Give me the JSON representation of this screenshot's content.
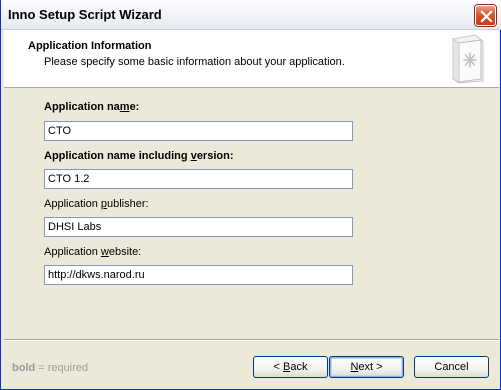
{
  "window": {
    "title": "Inno Setup Script Wizard"
  },
  "header": {
    "title": "Application Information",
    "subtitle": "Please specify some basic information about your application."
  },
  "fields": [
    {
      "label_pre": "Application na",
      "label_accel": "m",
      "label_post": "e:",
      "bold": true,
      "value": "CTO"
    },
    {
      "label_pre": "Application name including ",
      "label_accel": "v",
      "label_post": "ersion:",
      "bold": true,
      "value": "CTO 1.2"
    },
    {
      "label_pre": "Application ",
      "label_accel": "p",
      "label_post": "ublisher:",
      "bold": false,
      "value": "DHSI Labs"
    },
    {
      "label_pre": "Application ",
      "label_accel": "w",
      "label_post": "ebsite:",
      "bold": false,
      "value": "http://dkws.narod.ru"
    }
  ],
  "footer": {
    "note_bold": "bold",
    "note_rest": " = required",
    "back_pre": "< ",
    "back_accel": "B",
    "back_post": "ack",
    "next_accel": "N",
    "next_post": "ext >",
    "cancel_label": "Cancel"
  },
  "colors": {
    "dialog_bg": "#ece9d8",
    "input_border": "#7f9db9",
    "close_button": "#d6572e"
  },
  "icons": {
    "close": "close-icon",
    "wizard": "wizard-page-icon"
  }
}
